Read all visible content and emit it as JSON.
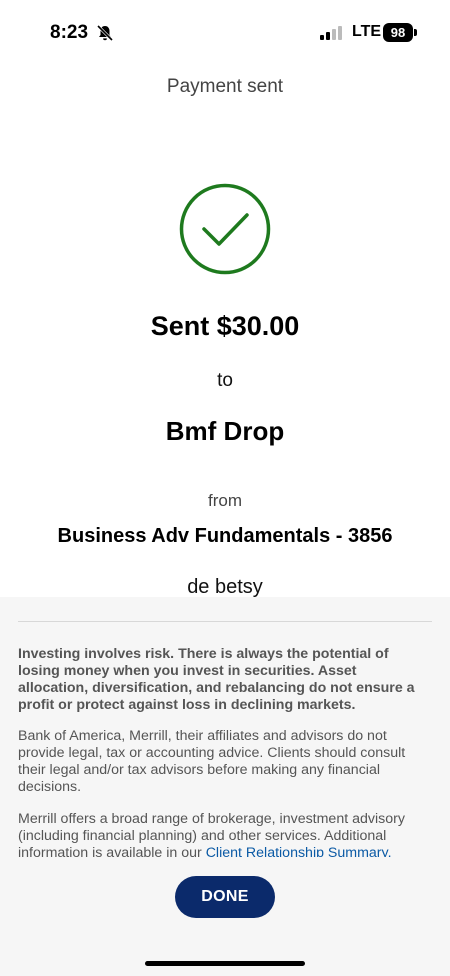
{
  "status_bar": {
    "time": "8:23",
    "network": "LTE",
    "battery": "98"
  },
  "header": {
    "title": "Payment sent"
  },
  "confirmation": {
    "icon": "check-circle-icon",
    "success_color": "#1e7a1e",
    "amount_text": "Sent $30.00",
    "to_label": "to",
    "recipient": "Bmf Drop",
    "from_label": "from",
    "from_account": "Business Adv Fundamentals - 3856",
    "memo": "de betsy"
  },
  "disclosures": {
    "paragraph_1": "Investing involves risk. There is always the potential of losing money when you invest in securities. Asset allocation, diversification, and rebalancing do not ensure a profit or protect against loss in declining markets.",
    "paragraph_2": "Bank of America, Merrill, their affiliates and advisors do not provide legal, tax or accounting advice. Clients should consult their legal and/or tax advisors before making any financial decisions.",
    "paragraph_3_prefix": "Merrill offers a broad range of brokerage, investment advisory (including financial planning) and other services. Additional information is available in our ",
    "paragraph_3_link": "Client Relationship Summary."
  },
  "actions": {
    "done_label": "DONE",
    "done_color": "#0b2a6b"
  }
}
